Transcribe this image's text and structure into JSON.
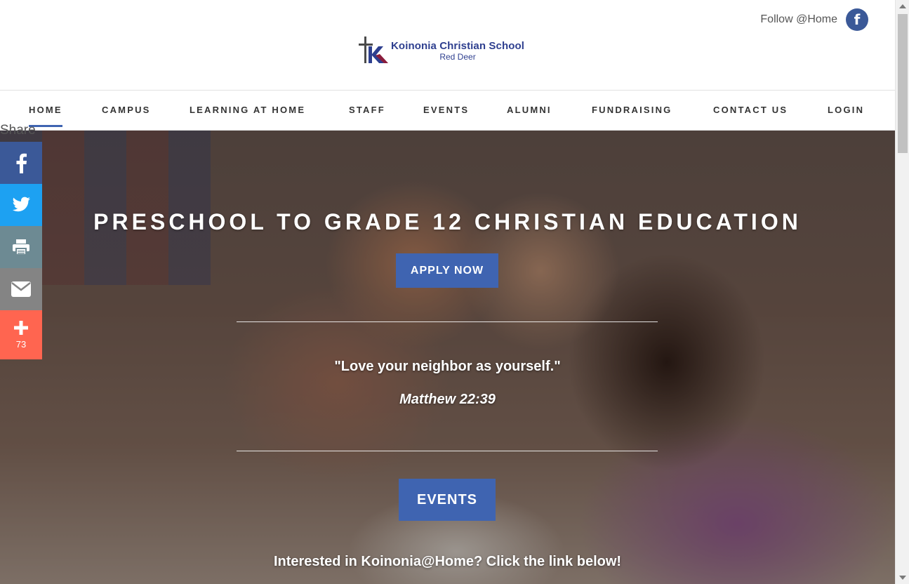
{
  "header": {
    "follow_text": "Follow @Home",
    "facebook_icon_glyph": "f",
    "logo_name": "Koinonia Christian School",
    "logo_sub": "Red Deer"
  },
  "nav": {
    "items": [
      {
        "label": "HOME",
        "active": true
      },
      {
        "label": "CAMPUS"
      },
      {
        "label": "LEARNING AT HOME"
      },
      {
        "label": "STAFF"
      },
      {
        "label": "EVENTS"
      },
      {
        "label": "ALUMNI"
      },
      {
        "label": "FUNDRAISING"
      },
      {
        "label": "CONTACT US"
      },
      {
        "label": "LOGIN"
      }
    ]
  },
  "share": {
    "label": "Share",
    "count": "73",
    "icons": [
      "facebook-icon",
      "twitter-icon",
      "print-icon",
      "email-icon",
      "plus-icon"
    ]
  },
  "hero": {
    "title": "PRESCHOOL TO GRADE 12 CHRISTIAN EDUCATION",
    "apply_label": "APPLY NOW",
    "quote": "\"Love your neighbor as yourself.\"",
    "verse": "Matthew 22:39",
    "events_label": "EVENTS",
    "interest_text": "Interested in Koinonia@Home? Click the link below!"
  },
  "colors": {
    "accent": "#3f64b1",
    "logo_blue": "#2e3f8f",
    "facebook": "#3b5998",
    "twitter": "#1da1f2",
    "print": "#6d8a93",
    "email": "#848484",
    "more": "#ff6550"
  }
}
